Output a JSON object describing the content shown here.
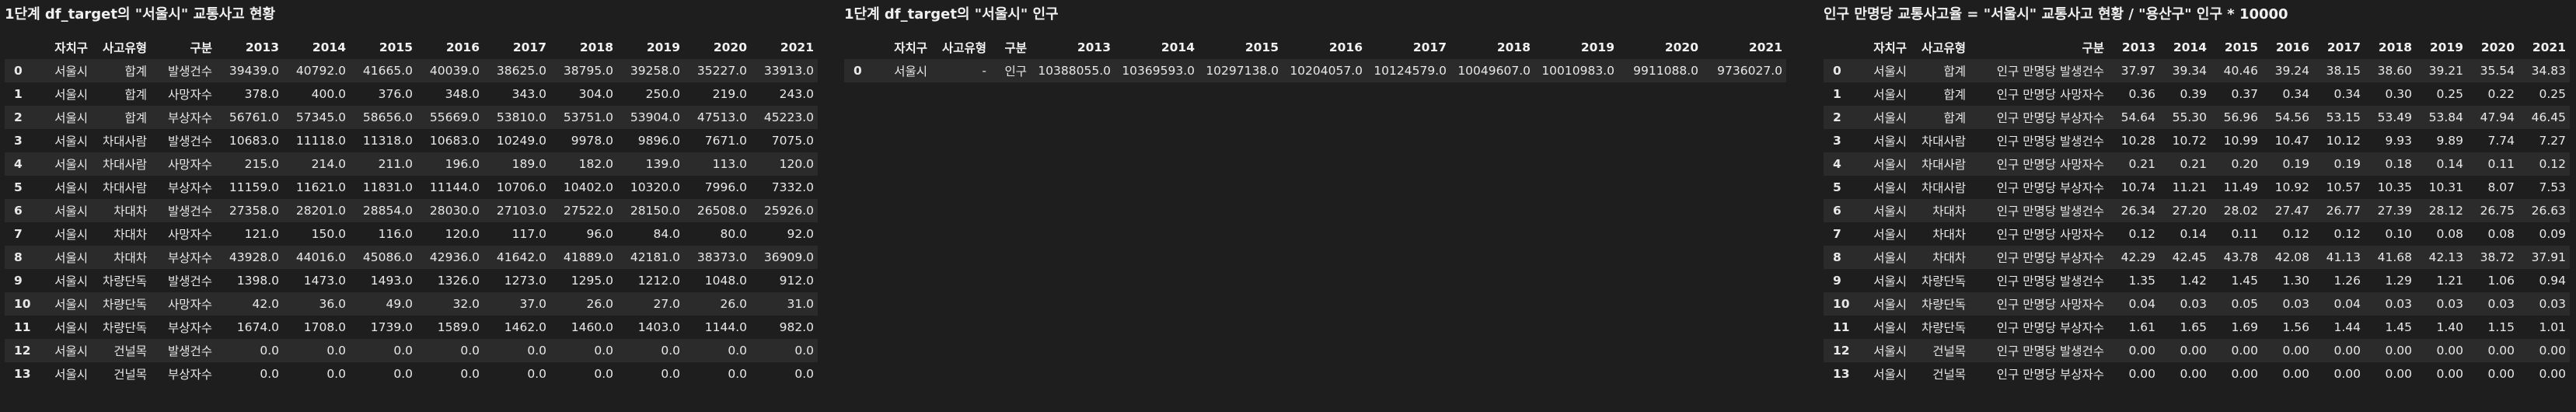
{
  "panels": [
    {
      "title": "1단계 df_target의 \"서울시\" 교통사고 현황",
      "columns": [
        "",
        "자치구",
        "사고유형",
        "구분",
        "2013",
        "2014",
        "2015",
        "2016",
        "2017",
        "2018",
        "2019",
        "2020",
        "2021"
      ],
      "rows": [
        [
          "0",
          "서울시",
          "합계",
          "발생건수",
          "39439.0",
          "40792.0",
          "41665.0",
          "40039.0",
          "38625.0",
          "38795.0",
          "39258.0",
          "35227.0",
          "33913.0"
        ],
        [
          "1",
          "서울시",
          "합계",
          "사망자수",
          "378.0",
          "400.0",
          "376.0",
          "348.0",
          "343.0",
          "304.0",
          "250.0",
          "219.0",
          "243.0"
        ],
        [
          "2",
          "서울시",
          "합계",
          "부상자수",
          "56761.0",
          "57345.0",
          "58656.0",
          "55669.0",
          "53810.0",
          "53751.0",
          "53904.0",
          "47513.0",
          "45223.0"
        ],
        [
          "3",
          "서울시",
          "차대사람",
          "발생건수",
          "10683.0",
          "11118.0",
          "11318.0",
          "10683.0",
          "10249.0",
          "9978.0",
          "9896.0",
          "7671.0",
          "7075.0"
        ],
        [
          "4",
          "서울시",
          "차대사람",
          "사망자수",
          "215.0",
          "214.0",
          "211.0",
          "196.0",
          "189.0",
          "182.0",
          "139.0",
          "113.0",
          "120.0"
        ],
        [
          "5",
          "서울시",
          "차대사람",
          "부상자수",
          "11159.0",
          "11621.0",
          "11831.0",
          "11144.0",
          "10706.0",
          "10402.0",
          "10320.0",
          "7996.0",
          "7332.0"
        ],
        [
          "6",
          "서울시",
          "차대차",
          "발생건수",
          "27358.0",
          "28201.0",
          "28854.0",
          "28030.0",
          "27103.0",
          "27522.0",
          "28150.0",
          "26508.0",
          "25926.0"
        ],
        [
          "7",
          "서울시",
          "차대차",
          "사망자수",
          "121.0",
          "150.0",
          "116.0",
          "120.0",
          "117.0",
          "96.0",
          "84.0",
          "80.0",
          "92.0"
        ],
        [
          "8",
          "서울시",
          "차대차",
          "부상자수",
          "43928.0",
          "44016.0",
          "45086.0",
          "42936.0",
          "41642.0",
          "41889.0",
          "42181.0",
          "38373.0",
          "36909.0"
        ],
        [
          "9",
          "서울시",
          "차량단독",
          "발생건수",
          "1398.0",
          "1473.0",
          "1493.0",
          "1326.0",
          "1273.0",
          "1295.0",
          "1212.0",
          "1048.0",
          "912.0"
        ],
        [
          "10",
          "서울시",
          "차량단독",
          "사망자수",
          "42.0",
          "36.0",
          "49.0",
          "32.0",
          "37.0",
          "26.0",
          "27.0",
          "26.0",
          "31.0"
        ],
        [
          "11",
          "서울시",
          "차량단독",
          "부상자수",
          "1674.0",
          "1708.0",
          "1739.0",
          "1589.0",
          "1462.0",
          "1460.0",
          "1403.0",
          "1144.0",
          "982.0"
        ],
        [
          "12",
          "서울시",
          "건널목",
          "발생건수",
          "0.0",
          "0.0",
          "0.0",
          "0.0",
          "0.0",
          "0.0",
          "0.0",
          "0.0",
          "0.0"
        ],
        [
          "13",
          "서울시",
          "건널목",
          "부상자수",
          "0.0",
          "0.0",
          "0.0",
          "0.0",
          "0.0",
          "0.0",
          "0.0",
          "0.0",
          "0.0"
        ]
      ]
    },
    {
      "title": "1단계 df_target의 \"서울시\" 인구",
      "columns": [
        "",
        "자치구",
        "사고유형",
        "구분",
        "2013",
        "2014",
        "2015",
        "2016",
        "2017",
        "2018",
        "2019",
        "2020",
        "2021"
      ],
      "rows": [
        [
          "0",
          "서울시",
          "-",
          "인구",
          "10388055.0",
          "10369593.0",
          "10297138.0",
          "10204057.0",
          "10124579.0",
          "10049607.0",
          "10010983.0",
          "9911088.0",
          "9736027.0"
        ]
      ]
    },
    {
      "title": "인구 만명당 교통사고율 = \"서울시\" 교통사고 현황 / \"용산구\" 인구 * 10000",
      "columns": [
        "",
        "자치구",
        "사고유형",
        "구분",
        "2013",
        "2014",
        "2015",
        "2016",
        "2017",
        "2018",
        "2019",
        "2020",
        "2021"
      ],
      "rows": [
        [
          "0",
          "서울시",
          "합계",
          "인구 만명당 발생건수",
          "37.97",
          "39.34",
          "40.46",
          "39.24",
          "38.15",
          "38.60",
          "39.21",
          "35.54",
          "34.83"
        ],
        [
          "1",
          "서울시",
          "합계",
          "인구 만명당 사망자수",
          "0.36",
          "0.39",
          "0.37",
          "0.34",
          "0.34",
          "0.30",
          "0.25",
          "0.22",
          "0.25"
        ],
        [
          "2",
          "서울시",
          "합계",
          "인구 만명당 부상자수",
          "54.64",
          "55.30",
          "56.96",
          "54.56",
          "53.15",
          "53.49",
          "53.84",
          "47.94",
          "46.45"
        ],
        [
          "3",
          "서울시",
          "차대사람",
          "인구 만명당 발생건수",
          "10.28",
          "10.72",
          "10.99",
          "10.47",
          "10.12",
          "9.93",
          "9.89",
          "7.74",
          "7.27"
        ],
        [
          "4",
          "서울시",
          "차대사람",
          "인구 만명당 사망자수",
          "0.21",
          "0.21",
          "0.20",
          "0.19",
          "0.19",
          "0.18",
          "0.14",
          "0.11",
          "0.12"
        ],
        [
          "5",
          "서울시",
          "차대사람",
          "인구 만명당 부상자수",
          "10.74",
          "11.21",
          "11.49",
          "10.92",
          "10.57",
          "10.35",
          "10.31",
          "8.07",
          "7.53"
        ],
        [
          "6",
          "서울시",
          "차대차",
          "인구 만명당 발생건수",
          "26.34",
          "27.20",
          "28.02",
          "27.47",
          "26.77",
          "27.39",
          "28.12",
          "26.75",
          "26.63"
        ],
        [
          "7",
          "서울시",
          "차대차",
          "인구 만명당 사망자수",
          "0.12",
          "0.14",
          "0.11",
          "0.12",
          "0.12",
          "0.10",
          "0.08",
          "0.08",
          "0.09"
        ],
        [
          "8",
          "서울시",
          "차대차",
          "인구 만명당 부상자수",
          "42.29",
          "42.45",
          "43.78",
          "42.08",
          "41.13",
          "41.68",
          "42.13",
          "38.72",
          "37.91"
        ],
        [
          "9",
          "서울시",
          "차량단독",
          "인구 만명당 발생건수",
          "1.35",
          "1.42",
          "1.45",
          "1.30",
          "1.26",
          "1.29",
          "1.21",
          "1.06",
          "0.94"
        ],
        [
          "10",
          "서울시",
          "차량단독",
          "인구 만명당 사망자수",
          "0.04",
          "0.03",
          "0.05",
          "0.03",
          "0.04",
          "0.03",
          "0.03",
          "0.03",
          "0.03"
        ],
        [
          "11",
          "서울시",
          "차량단독",
          "인구 만명당 부상자수",
          "1.61",
          "1.65",
          "1.69",
          "1.56",
          "1.44",
          "1.45",
          "1.40",
          "1.15",
          "1.01"
        ],
        [
          "12",
          "서울시",
          "건널목",
          "인구 만명당 발생건수",
          "0.00",
          "0.00",
          "0.00",
          "0.00",
          "0.00",
          "0.00",
          "0.00",
          "0.00",
          "0.00"
        ],
        [
          "13",
          "서울시",
          "건널목",
          "인구 만명당 부상자수",
          "0.00",
          "0.00",
          "0.00",
          "0.00",
          "0.00",
          "0.00",
          "0.00",
          "0.00",
          "0.00"
        ]
      ]
    }
  ]
}
